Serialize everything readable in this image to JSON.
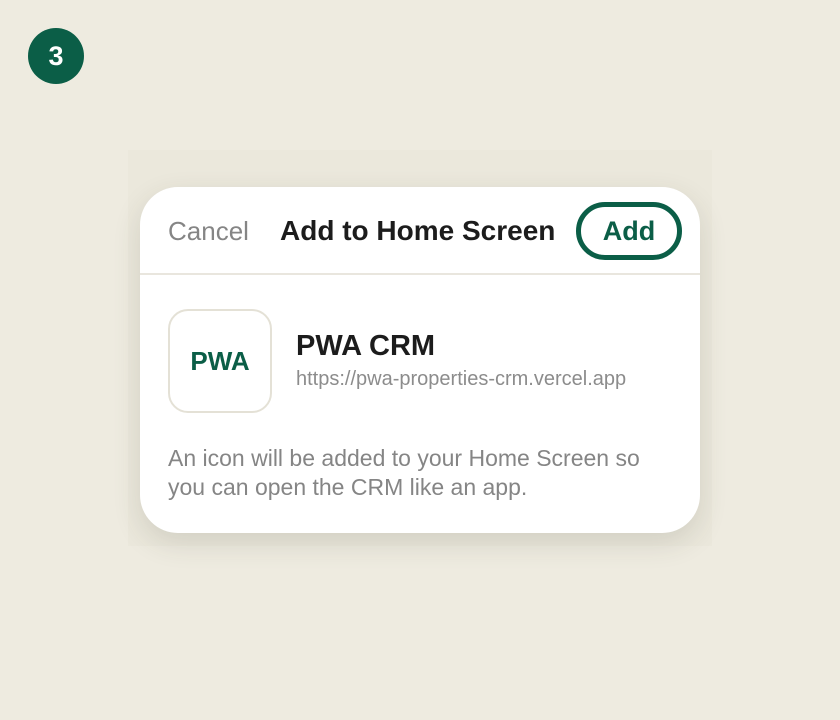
{
  "step": {
    "number": "3"
  },
  "dialog": {
    "cancel_label": "Cancel",
    "title": "Add to Home Screen",
    "add_label": "Add",
    "app": {
      "icon_text": "PWA",
      "name": "PWA CRM",
      "url": "https://pwa-properties-crm.vercel.app"
    },
    "description": "An icon will be added to your Home Screen so you can open the CRM like an app."
  },
  "colors": {
    "accent": "#0b5e47",
    "background": "#eeebe0",
    "sheet": "#ffffff",
    "muted_text": "#858585"
  }
}
